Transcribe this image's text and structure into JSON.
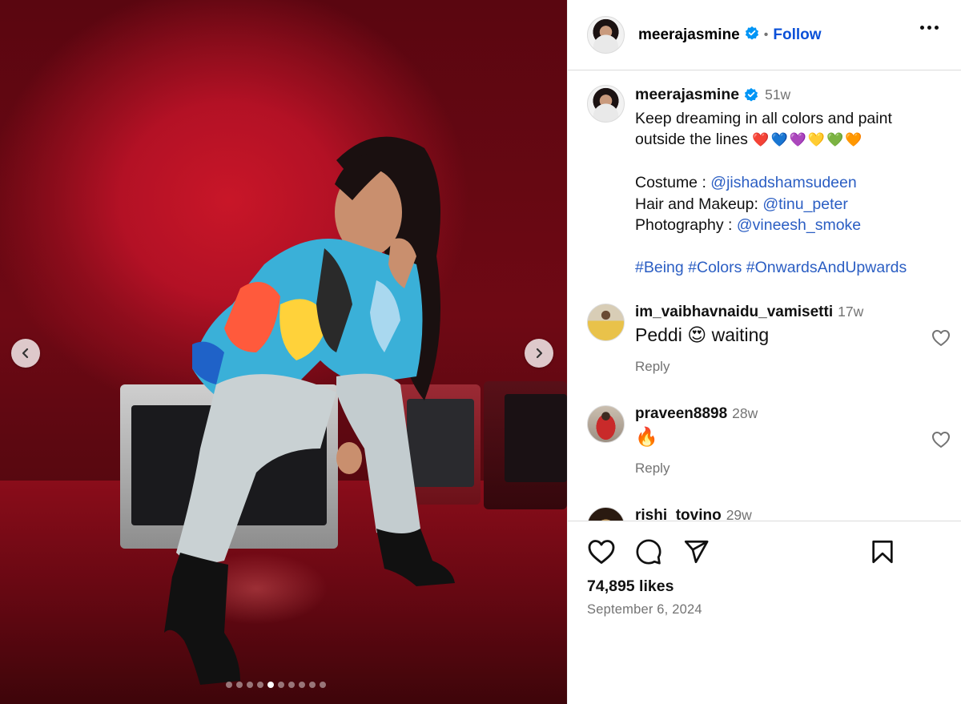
{
  "post": {
    "username": "meerajasmine",
    "follow_label": "Follow",
    "separator": "•",
    "likes": "74,895 likes",
    "date": "September 6, 2024"
  },
  "caption": {
    "username": "meerajasmine",
    "time": "51w",
    "line1": "Keep dreaming in all colors and paint",
    "line2": "outside the lines",
    "hearts": "❤️💙💜💛💚🧡",
    "costume_label": "Costume : ",
    "costume_mention": "@jishadshamsudeen",
    "hair_label": "Hair and Makeup: ",
    "hair_mention": "@tinu_peter",
    "photo_label": "Photography : ",
    "photo_mention": "@vineesh_smoke",
    "tags": [
      "#Being",
      "#Colors",
      "#OnwardsAndUpwards"
    ]
  },
  "comments": [
    {
      "username": "im_vaibhavnaidu_vamisetti",
      "time": "17w",
      "text": "Peddi 😍 waiting",
      "reply": "Reply"
    },
    {
      "username": "praveen8898",
      "time": "28w",
      "text": "🔥",
      "reply": "Reply"
    },
    {
      "username": "rishi_tovino",
      "time": "29w"
    }
  ],
  "carousel": {
    "total_slides": 10,
    "active_slide": 5
  },
  "icons": {
    "verified": "verified-badge-icon",
    "more": "more-options-icon",
    "prev": "chevron-left-icon",
    "next": "chevron-right-icon",
    "like": "heart-icon",
    "comment": "comment-icon",
    "share": "share-icon",
    "save": "bookmark-icon"
  },
  "colors": {
    "link": "#0a50d8",
    "mention": "#2b5ec3",
    "verified": "#0095f6",
    "muted": "#737373"
  }
}
